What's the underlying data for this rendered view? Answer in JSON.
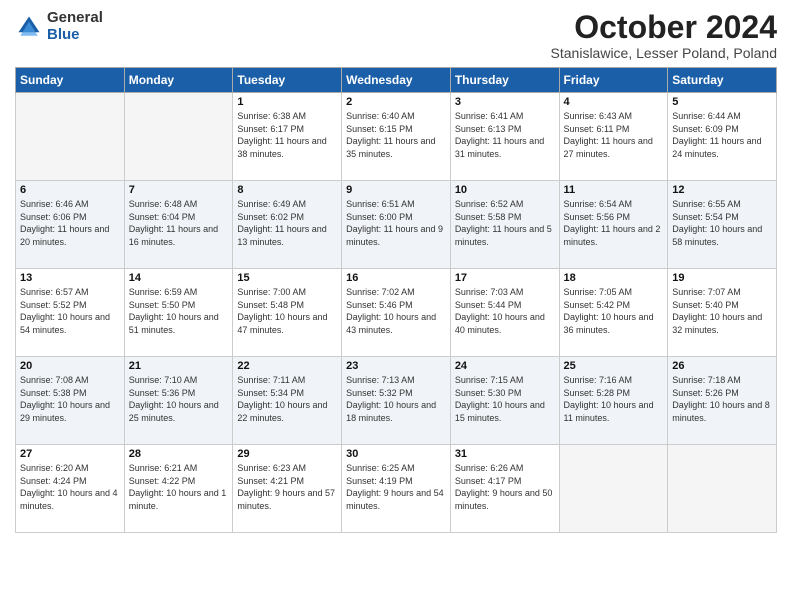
{
  "logo": {
    "general": "General",
    "blue": "Blue"
  },
  "title": "October 2024",
  "location": "Stanislawice, Lesser Poland, Poland",
  "days_of_week": [
    "Sunday",
    "Monday",
    "Tuesday",
    "Wednesday",
    "Thursday",
    "Friday",
    "Saturday"
  ],
  "weeks": [
    [
      {
        "day": "",
        "empty": true
      },
      {
        "day": "",
        "empty": true
      },
      {
        "day": "1",
        "sunrise": "Sunrise: 6:38 AM",
        "sunset": "Sunset: 6:17 PM",
        "daylight": "Daylight: 11 hours and 38 minutes."
      },
      {
        "day": "2",
        "sunrise": "Sunrise: 6:40 AM",
        "sunset": "Sunset: 6:15 PM",
        "daylight": "Daylight: 11 hours and 35 minutes."
      },
      {
        "day": "3",
        "sunrise": "Sunrise: 6:41 AM",
        "sunset": "Sunset: 6:13 PM",
        "daylight": "Daylight: 11 hours and 31 minutes."
      },
      {
        "day": "4",
        "sunrise": "Sunrise: 6:43 AM",
        "sunset": "Sunset: 6:11 PM",
        "daylight": "Daylight: 11 hours and 27 minutes."
      },
      {
        "day": "5",
        "sunrise": "Sunrise: 6:44 AM",
        "sunset": "Sunset: 6:09 PM",
        "daylight": "Daylight: 11 hours and 24 minutes."
      }
    ],
    [
      {
        "day": "6",
        "sunrise": "Sunrise: 6:46 AM",
        "sunset": "Sunset: 6:06 PM",
        "daylight": "Daylight: 11 hours and 20 minutes."
      },
      {
        "day": "7",
        "sunrise": "Sunrise: 6:48 AM",
        "sunset": "Sunset: 6:04 PM",
        "daylight": "Daylight: 11 hours and 16 minutes."
      },
      {
        "day": "8",
        "sunrise": "Sunrise: 6:49 AM",
        "sunset": "Sunset: 6:02 PM",
        "daylight": "Daylight: 11 hours and 13 minutes."
      },
      {
        "day": "9",
        "sunrise": "Sunrise: 6:51 AM",
        "sunset": "Sunset: 6:00 PM",
        "daylight": "Daylight: 11 hours and 9 minutes."
      },
      {
        "day": "10",
        "sunrise": "Sunrise: 6:52 AM",
        "sunset": "Sunset: 5:58 PM",
        "daylight": "Daylight: 11 hours and 5 minutes."
      },
      {
        "day": "11",
        "sunrise": "Sunrise: 6:54 AM",
        "sunset": "Sunset: 5:56 PM",
        "daylight": "Daylight: 11 hours and 2 minutes."
      },
      {
        "day": "12",
        "sunrise": "Sunrise: 6:55 AM",
        "sunset": "Sunset: 5:54 PM",
        "daylight": "Daylight: 10 hours and 58 minutes."
      }
    ],
    [
      {
        "day": "13",
        "sunrise": "Sunrise: 6:57 AM",
        "sunset": "Sunset: 5:52 PM",
        "daylight": "Daylight: 10 hours and 54 minutes."
      },
      {
        "day": "14",
        "sunrise": "Sunrise: 6:59 AM",
        "sunset": "Sunset: 5:50 PM",
        "daylight": "Daylight: 10 hours and 51 minutes."
      },
      {
        "day": "15",
        "sunrise": "Sunrise: 7:00 AM",
        "sunset": "Sunset: 5:48 PM",
        "daylight": "Daylight: 10 hours and 47 minutes."
      },
      {
        "day": "16",
        "sunrise": "Sunrise: 7:02 AM",
        "sunset": "Sunset: 5:46 PM",
        "daylight": "Daylight: 10 hours and 43 minutes."
      },
      {
        "day": "17",
        "sunrise": "Sunrise: 7:03 AM",
        "sunset": "Sunset: 5:44 PM",
        "daylight": "Daylight: 10 hours and 40 minutes."
      },
      {
        "day": "18",
        "sunrise": "Sunrise: 7:05 AM",
        "sunset": "Sunset: 5:42 PM",
        "daylight": "Daylight: 10 hours and 36 minutes."
      },
      {
        "day": "19",
        "sunrise": "Sunrise: 7:07 AM",
        "sunset": "Sunset: 5:40 PM",
        "daylight": "Daylight: 10 hours and 32 minutes."
      }
    ],
    [
      {
        "day": "20",
        "sunrise": "Sunrise: 7:08 AM",
        "sunset": "Sunset: 5:38 PM",
        "daylight": "Daylight: 10 hours and 29 minutes."
      },
      {
        "day": "21",
        "sunrise": "Sunrise: 7:10 AM",
        "sunset": "Sunset: 5:36 PM",
        "daylight": "Daylight: 10 hours and 25 minutes."
      },
      {
        "day": "22",
        "sunrise": "Sunrise: 7:11 AM",
        "sunset": "Sunset: 5:34 PM",
        "daylight": "Daylight: 10 hours and 22 minutes."
      },
      {
        "day": "23",
        "sunrise": "Sunrise: 7:13 AM",
        "sunset": "Sunset: 5:32 PM",
        "daylight": "Daylight: 10 hours and 18 minutes."
      },
      {
        "day": "24",
        "sunrise": "Sunrise: 7:15 AM",
        "sunset": "Sunset: 5:30 PM",
        "daylight": "Daylight: 10 hours and 15 minutes."
      },
      {
        "day": "25",
        "sunrise": "Sunrise: 7:16 AM",
        "sunset": "Sunset: 5:28 PM",
        "daylight": "Daylight: 10 hours and 11 minutes."
      },
      {
        "day": "26",
        "sunrise": "Sunrise: 7:18 AM",
        "sunset": "Sunset: 5:26 PM",
        "daylight": "Daylight: 10 hours and 8 minutes."
      }
    ],
    [
      {
        "day": "27",
        "sunrise": "Sunrise: 6:20 AM",
        "sunset": "Sunset: 4:24 PM",
        "daylight": "Daylight: 10 hours and 4 minutes."
      },
      {
        "day": "28",
        "sunrise": "Sunrise: 6:21 AM",
        "sunset": "Sunset: 4:22 PM",
        "daylight": "Daylight: 10 hours and 1 minute."
      },
      {
        "day": "29",
        "sunrise": "Sunrise: 6:23 AM",
        "sunset": "Sunset: 4:21 PM",
        "daylight": "Daylight: 9 hours and 57 minutes."
      },
      {
        "day": "30",
        "sunrise": "Sunrise: 6:25 AM",
        "sunset": "Sunset: 4:19 PM",
        "daylight": "Daylight: 9 hours and 54 minutes."
      },
      {
        "day": "31",
        "sunrise": "Sunrise: 6:26 AM",
        "sunset": "Sunset: 4:17 PM",
        "daylight": "Daylight: 9 hours and 50 minutes."
      },
      {
        "day": "",
        "empty": true
      },
      {
        "day": "",
        "empty": true
      }
    ]
  ]
}
